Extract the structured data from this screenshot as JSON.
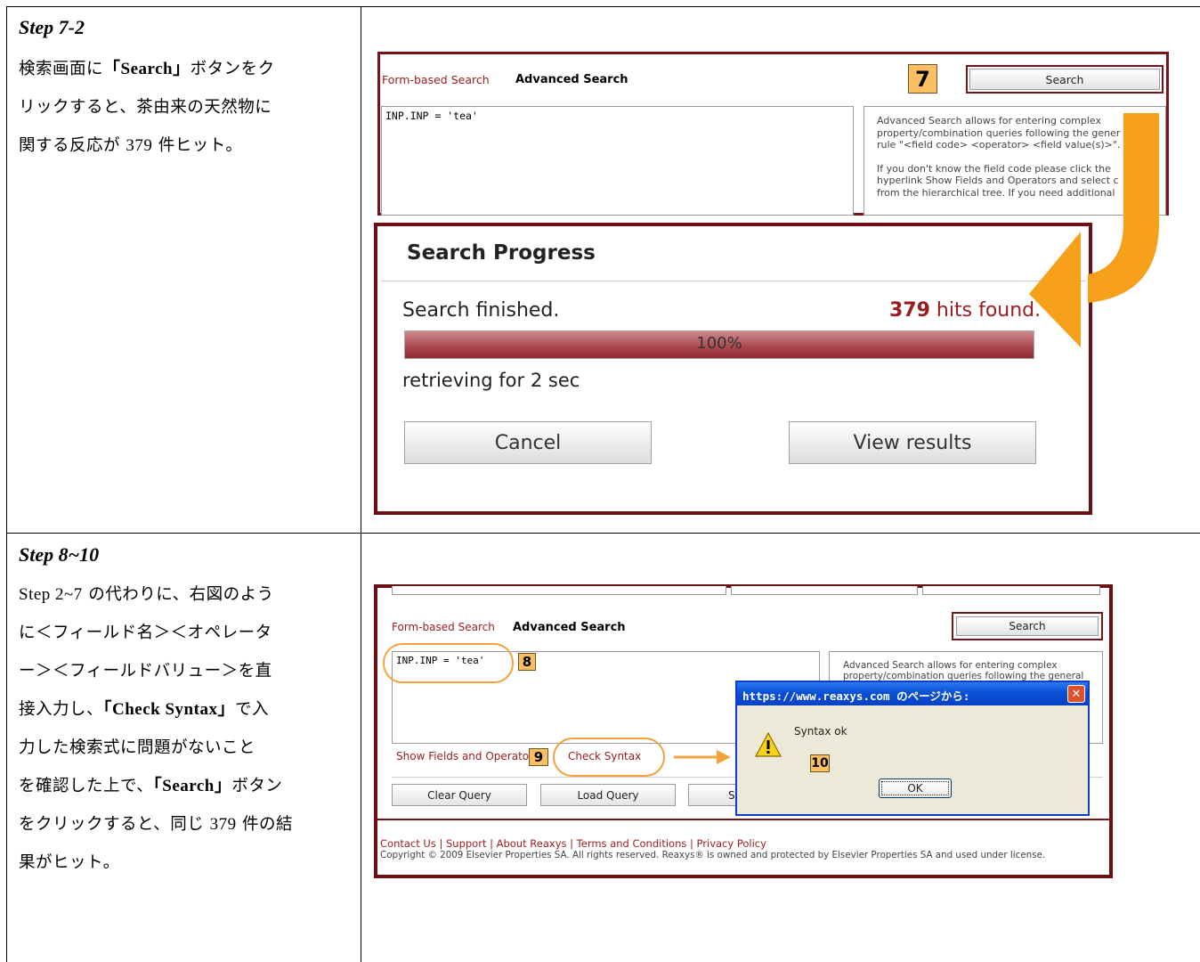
{
  "step1": {
    "title": "Step 7-2",
    "line1_a": "検索画面に",
    "line1_b": "「Search」",
    "line1_c": "ボタンをク",
    "line2": "リックすると、茶由来の天然物に",
    "line3_a": "関する反応が ",
    "line3_num": "379",
    "line3_b": " 件ヒット。"
  },
  "panel1": {
    "tab_form": "Form-based Search",
    "tab_adv": "Advanced Search",
    "badge": "7",
    "search_btn": "Search",
    "query": "INP.INP = 'tea'",
    "help_lines": [
      "Advanced Search allows for entering complex",
      "property/combination queries following the gener",
      "rule \"<field code> <operator> <field value(s)>\".",
      "",
      "If you don't know the field code please click the",
      "hyperlink Show Fields and Operators and select c",
      "from the hierarchical tree. If you need additional"
    ]
  },
  "progress": {
    "title": "Search Progress",
    "status": "Search finished.",
    "hits_num": "379",
    "hits_text": " hits found.",
    "percent_label": "100%",
    "progress_fraction": 1.0,
    "retrieving": "retrieving for 2 sec",
    "cancel": "Cancel",
    "view_results": "View results"
  },
  "step2": {
    "title": "Step 8~10",
    "line1_a": "Step 2~7",
    "line1_b": " の代わりに、右図のよう",
    "line2": "に＜フィールド名＞＜オペレータ",
    "line3": "ー＞＜フィールドバリュー＞を直",
    "line4_a": "接入力し、",
    "line4_b": "「Check  Syntax」",
    "line4_c": "で入",
    "line5": "力した検索式に問題がないこと",
    "line6_a": "を確認した上で、",
    "line6_b": "「Search」",
    "line6_c": "ボタン",
    "line7_a": "をクリックすると、同じ ",
    "line7_num": "379",
    "line7_b": " 件の結",
    "line8": "果がヒット。"
  },
  "panel2": {
    "tab_form": "Form-based Search",
    "tab_adv": "Advanced Search",
    "search_btn": "Search",
    "query": "INP.INP = 'tea'",
    "badge8": "8",
    "badge9": "9",
    "badge10": "10",
    "help_line1": "Advanced Search allows for entering complex",
    "help_line2": "property/combination queries following the general",
    "show_fields": "Show Fields and Operato",
    "check_syntax": "Check Syntax",
    "clear_query": "Clear Query",
    "load_query": "Load Query",
    "sa": "Sa",
    "footer_links": "Contact Us | Support | About Reaxys | Terms and Conditions | Privacy Policy",
    "copyright": "Copyright © 2009 Elsevier Properties SA. All rights reserved. Reaxys® is owned and protected by Elsevier Properties SA and used under license."
  },
  "dialog": {
    "title": "https://www.reaxys.com のページから:",
    "message": "Syntax ok",
    "ok": "OK"
  },
  "colors": {
    "panel_border": "#7a1317",
    "link_red": "#9a1c1c",
    "badge": "#fbbf63",
    "arrow_orange": "#f7a01c",
    "xp_blue": "#0a4fd8"
  }
}
